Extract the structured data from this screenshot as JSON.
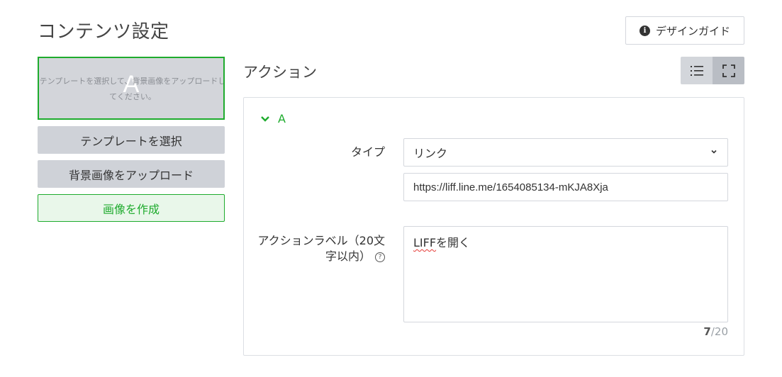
{
  "page": {
    "title": "コンテンツ設定"
  },
  "guide_button": {
    "label": "デザインガイド",
    "icon": "info-icon"
  },
  "preview": {
    "letter": "A",
    "message": "テンプレートを選択して、背景画像をアップロードしてください。"
  },
  "sidebar_buttons": {
    "select_template": "テンプレートを選択",
    "upload_background": "背景画像をアップロード",
    "create_image": "画像を作成"
  },
  "action_section": {
    "title": "アクション",
    "view_toggle": [
      "list-icon",
      "fullscreen-icon"
    ]
  },
  "action_item": {
    "name": "A",
    "type_label": "タイプ",
    "type_value": "リンク",
    "url_value": "https://liff.line.me/1654085134-mKJA8Xja",
    "action_label_label": "アクションラベル（20文字以内）",
    "action_label_value_prefix": "LIFF",
    "action_label_value_suffix": "を開く",
    "char_count": "7",
    "char_limit": "/20",
    "help_icon": "?"
  },
  "colors": {
    "accent_green": "#1eab2d",
    "button_gray": "#cfd2d8",
    "create_bg": "#e9f7ea"
  }
}
